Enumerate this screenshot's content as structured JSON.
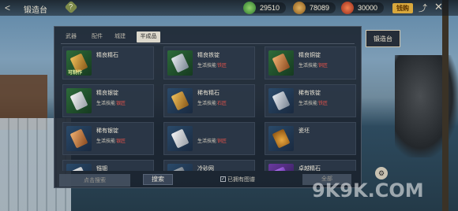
{
  "header": {
    "back_symbol": "<",
    "title": "锻造台",
    "help_symbol": "?",
    "resources": [
      {
        "icon": "jade-coin-icon",
        "amount": "29510"
      },
      {
        "icon": "copper-coin-icon",
        "amount": "78089"
      },
      {
        "icon": "red-crystal-icon",
        "amount": "30000"
      }
    ],
    "gold_badge": "钱购"
  },
  "tabs": [
    "武器",
    "配件",
    "城建",
    "半成品"
  ],
  "active_tab": "半成品",
  "items": [
    {
      "name": "精良精石",
      "tag": "可制作",
      "icon": "ore-icon",
      "bg": "green",
      "skill_prefix": "",
      "skill": ""
    },
    {
      "name": "精良铁锭",
      "tag": "",
      "icon": "iron-ingot-icon",
      "bg": "green",
      "skill_prefix": "生活技能",
      "skill": "铁匠"
    },
    {
      "name": "精良铜锭",
      "tag": "",
      "icon": "copper-ingot-icon",
      "bg": "green",
      "skill_prefix": "生活技能",
      "skill": "铜匠"
    },
    {
      "name": "精良银锭",
      "tag": "",
      "icon": "silver-ingot-icon",
      "bg": "green",
      "skill_prefix": "生活技能",
      "skill": "银匠"
    },
    {
      "name": "稀有精石",
      "tag": "",
      "icon": "rare-ore-icon",
      "bg": "blue",
      "skill_prefix": "生活技能",
      "skill": "石匠"
    },
    {
      "name": "稀有铁锭",
      "tag": "",
      "icon": "rare-iron-ingot-icon",
      "bg": "blue",
      "skill_prefix": "生活技能",
      "skill": "铁匠"
    },
    {
      "name": "稀有银锭",
      "tag": "",
      "icon": "rare-silver-ingot-icon",
      "bg": "blue",
      "skill_prefix": "生活技能",
      "skill": "银匠"
    },
    {
      "name": "",
      "tag": "",
      "icon": "rare-copper-ingot-icon",
      "bg": "blue",
      "skill_prefix": "生活技能",
      "skill": "铜匠"
    },
    {
      "name": "瓷坯",
      "tag": "",
      "icon": "porcelain-jar-icon",
      "bg": "blue",
      "skill_prefix": "",
      "skill": ""
    },
    {
      "name": "镪钿",
      "tag": "",
      "icon": "inlay-icon",
      "bg": "blue",
      "skill_prefix": "",
      "skill": ""
    },
    {
      "name": "冷砂网",
      "tag": "",
      "icon": "sand-net-icon",
      "bg": "blue",
      "skill_prefix": "",
      "skill": ""
    },
    {
      "name": "卓越精石",
      "tag": "",
      "icon": "excellent-ore-icon",
      "bg": "purple",
      "skill_prefix": "",
      "skill": ""
    }
  ],
  "bottom": {
    "search_placeholder": "点击搜索",
    "search_button": "搜索",
    "owned_label": "已拥有图谱",
    "filter_label": "全部"
  },
  "side_tab": "锻造台",
  "watermark": "9K9K.COM"
}
